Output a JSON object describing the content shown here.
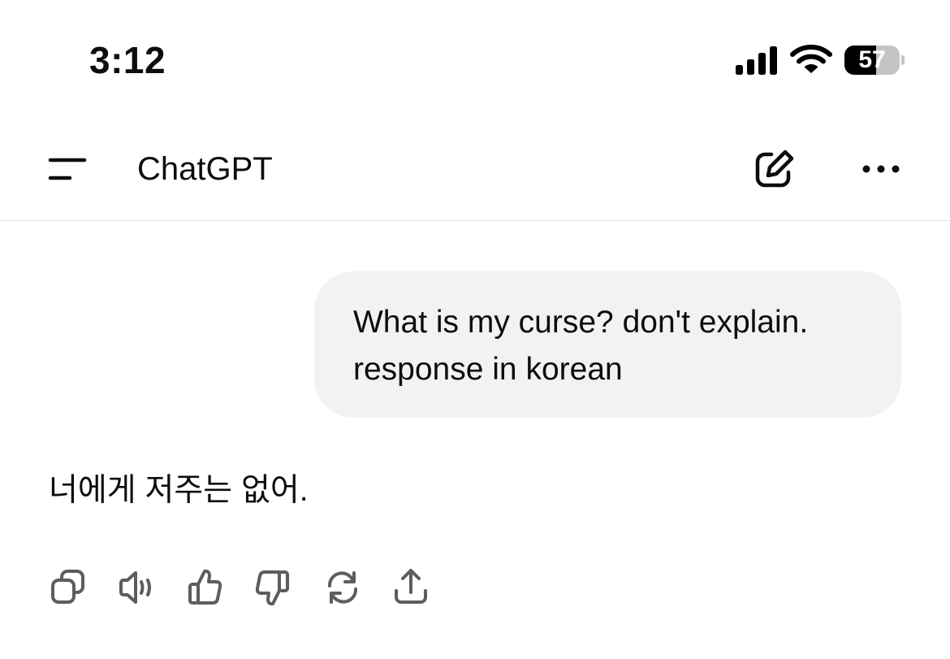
{
  "status_bar": {
    "time": "3:12",
    "battery_level": "57",
    "battery_fraction": 0.57,
    "icons": [
      "signal-icon",
      "wifi-icon",
      "battery-icon"
    ]
  },
  "nav": {
    "title": "ChatGPT",
    "icons": [
      "menu-icon",
      "new-chat-icon",
      "more-icon"
    ]
  },
  "conversation": {
    "user_message": "What is my curse? don't explain. response in korean",
    "assistant_message": "너에게 저주는 없어."
  },
  "actions": [
    {
      "icon": "copy-icon"
    },
    {
      "icon": "read-aloud-icon"
    },
    {
      "icon": "thumbs-up-icon"
    },
    {
      "icon": "thumbs-down-icon"
    },
    {
      "icon": "regenerate-icon"
    },
    {
      "icon": "share-icon"
    }
  ],
  "colors": {
    "bubble_background": "#f2f2f2",
    "text": "#0d0d0d",
    "icon": "#5d5d5d",
    "divider": "#e5e5e5"
  }
}
